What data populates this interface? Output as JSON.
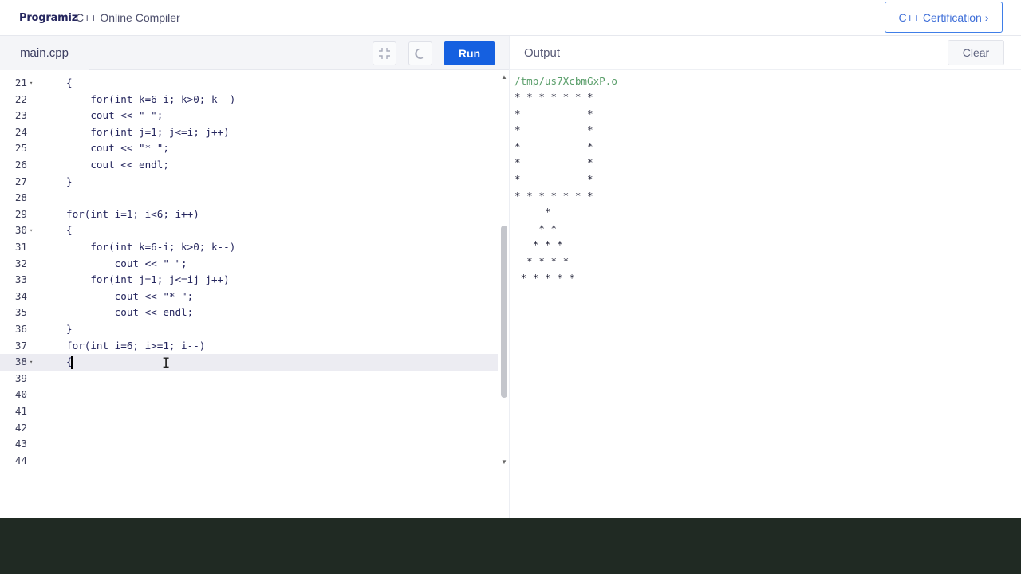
{
  "header": {
    "logo_text": "Programiz",
    "app_title": "C++ Online Compiler",
    "cert_button": "C++ Certification",
    "cert_chevron_icon": "chevron-right-icon"
  },
  "editor": {
    "file_tab": "main.cpp",
    "exit_fullscreen_icon": "collapse-icon",
    "theme_icon": "moon-icon",
    "run_label": "Run",
    "lines": [
      {
        "num": "21",
        "fold": true,
        "text": "{"
      },
      {
        "num": "22",
        "fold": false,
        "text": "    for(int k=6-i; k>0; k--)"
      },
      {
        "num": "23",
        "fold": false,
        "text": "    cout << \" \";"
      },
      {
        "num": "24",
        "fold": false,
        "text": "    for(int j=1; j<=i; j++)"
      },
      {
        "num": "25",
        "fold": false,
        "text": "    cout << \"* \";"
      },
      {
        "num": "26",
        "fold": false,
        "text": "    cout << endl;"
      },
      {
        "num": "27",
        "fold": false,
        "text": "}"
      },
      {
        "num": "28",
        "fold": false,
        "text": ""
      },
      {
        "num": "29",
        "fold": false,
        "text": "for(int i=1; i<6; i++)"
      },
      {
        "num": "30",
        "fold": true,
        "text": "{"
      },
      {
        "num": "31",
        "fold": false,
        "text": "    for(int k=6-i; k>0; k--)"
      },
      {
        "num": "32",
        "fold": false,
        "text": "        cout << \" \";"
      },
      {
        "num": "33",
        "fold": false,
        "text": "    for(int j=1; j<=ij j++)"
      },
      {
        "num": "34",
        "fold": false,
        "text": "        cout << \"* \";"
      },
      {
        "num": "35",
        "fold": false,
        "text": "        cout << endl;"
      },
      {
        "num": "36",
        "fold": false,
        "text": "}"
      },
      {
        "num": "37",
        "fold": false,
        "text": "for(int i=6; i>=1; i--)"
      },
      {
        "num": "38",
        "fold": true,
        "text": "{"
      },
      {
        "num": "39",
        "fold": false,
        "text": ""
      },
      {
        "num": "40",
        "fold": false,
        "text": ""
      },
      {
        "num": "41",
        "fold": false,
        "text": ""
      },
      {
        "num": "42",
        "fold": false,
        "text": ""
      },
      {
        "num": "43",
        "fold": false,
        "text": ""
      },
      {
        "num": "44",
        "fold": false,
        "text": ""
      }
    ],
    "active_line": "38"
  },
  "output": {
    "label": "Output",
    "clear_label": "Clear",
    "path": "/tmp/us7XcbmGxP.o",
    "lines": [
      "* * * * * * *",
      "*           *",
      "*           *",
      "*           *",
      "*           *",
      "*           *",
      "* * * * * * *",
      "     *",
      "    * *",
      "   * * *",
      "  * * * *",
      " * * * * *"
    ]
  },
  "colors": {
    "accent": "#1560e0",
    "output_path": "#5a9e6a",
    "bottom_strip": "#202a23"
  }
}
